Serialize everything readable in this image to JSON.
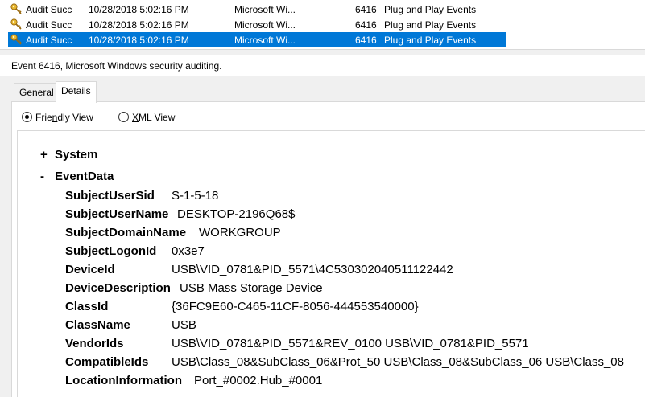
{
  "events": [
    {
      "level": "Audit Succ",
      "date": "10/28/2018 5:02:16 PM",
      "source": "Microsoft Wi...",
      "event_id": "6416",
      "category": "Plug and Play Events",
      "selected": false
    },
    {
      "level": "Audit Succ",
      "date": "10/28/2018 5:02:16 PM",
      "source": "Microsoft Wi...",
      "event_id": "6416",
      "category": "Plug and Play Events",
      "selected": false
    },
    {
      "level": "Audit Succ",
      "date": "10/28/2018 5:02:16 PM",
      "source": "Microsoft Wi...",
      "event_id": "6416",
      "category": "Plug and Play Events",
      "selected": true
    }
  ],
  "detail": {
    "header": "Event 6416, Microsoft Windows security auditing.",
    "tabs": [
      {
        "label": "General",
        "active": false
      },
      {
        "label": "Details",
        "active": true
      }
    ],
    "views": {
      "friendly": {
        "label_pre": "Frie",
        "label_ul": "n",
        "label_post": "dly View",
        "checked": true
      },
      "xml": {
        "label_pre": "",
        "label_ul": "X",
        "label_post": "ML View",
        "checked": false
      }
    },
    "tree": {
      "system": {
        "sign": "+",
        "label": "System"
      },
      "eventdata": {
        "sign": "-",
        "label": "EventData"
      },
      "fields": [
        {
          "name": "SubjectUserSid",
          "value": "S-1-5-18"
        },
        {
          "name": "SubjectUserName",
          "value": "DESKTOP-2196Q68$"
        },
        {
          "name": "SubjectDomainName",
          "value": "WORKGROUP"
        },
        {
          "name": "SubjectLogonId",
          "value": "0x3e7"
        },
        {
          "name": "DeviceId",
          "value": "USB\\VID_0781&PID_5571\\4C530302040511122442"
        },
        {
          "name": "DeviceDescription",
          "value": "USB Mass Storage Device"
        },
        {
          "name": "ClassId",
          "value": "{36FC9E60-C465-11CF-8056-444553540000}"
        },
        {
          "name": "ClassName",
          "value": "USB"
        },
        {
          "name": "VendorIds",
          "value": "USB\\VID_0781&PID_5571&REV_0100 USB\\VID_0781&PID_5571"
        },
        {
          "name": "CompatibleIds",
          "value": "USB\\Class_08&SubClass_06&Prot_50 USB\\Class_08&SubClass_06 USB\\Class_08"
        },
        {
          "name": "LocationInformation",
          "value": "Port_#0002.Hub_#0001"
        }
      ]
    }
  },
  "colors": {
    "selection": "#0078d7",
    "key_icon": "#d9a520"
  }
}
